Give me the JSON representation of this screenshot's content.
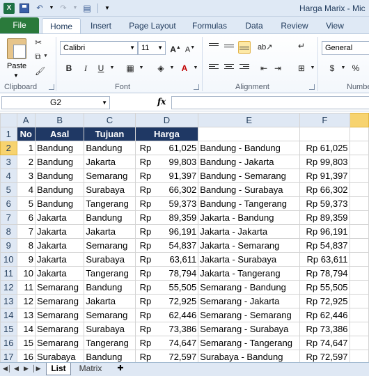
{
  "window": {
    "title": "Harga Marix - Mic"
  },
  "ribbon": {
    "tabs": [
      "File",
      "Home",
      "Insert",
      "Page Layout",
      "Formulas",
      "Data",
      "Review",
      "View"
    ],
    "clipboard": {
      "paste_label": "Paste",
      "group_label": "Clipboard"
    },
    "font": {
      "font_name": "Calibri",
      "font_size": "11",
      "group_label": "Font",
      "bold": "B",
      "italic": "I",
      "underline": "U"
    },
    "alignment": {
      "group_label": "Alignment"
    },
    "number": {
      "format": "General",
      "currency": "$",
      "percent": "%",
      "group_label": "Numbe"
    }
  },
  "formula_bar": {
    "name_box": "G2",
    "fx": "fx",
    "value": ""
  },
  "grid": {
    "columns": [
      "A",
      "B",
      "C",
      "D",
      "E",
      "F"
    ],
    "header_row": {
      "no": "No",
      "asal": "Asal",
      "tujuan": "Tujuan",
      "harga": "Harga"
    },
    "rows": [
      {
        "n": "2",
        "no": "1",
        "asal": "Bandung",
        "tujuan": "Bandung",
        "rp": "Rp",
        "harga": "61,025",
        "route": "Bandung - Bandung",
        "price": "Rp 61,025"
      },
      {
        "n": "3",
        "no": "2",
        "asal": "Bandung",
        "tujuan": "Jakarta",
        "rp": "Rp",
        "harga": "99,803",
        "route": "Bandung - Jakarta",
        "price": "Rp 99,803"
      },
      {
        "n": "4",
        "no": "3",
        "asal": "Bandung",
        "tujuan": "Semarang",
        "rp": "Rp",
        "harga": "91,397",
        "route": "Bandung - Semarang",
        "price": "Rp 91,397"
      },
      {
        "n": "5",
        "no": "4",
        "asal": "Bandung",
        "tujuan": "Surabaya",
        "rp": "Rp",
        "harga": "66,302",
        "route": "Bandung - Surabaya",
        "price": "Rp 66,302"
      },
      {
        "n": "6",
        "no": "5",
        "asal": "Bandung",
        "tujuan": "Tangerang",
        "rp": "Rp",
        "harga": "59,373",
        "route": "Bandung - Tangerang",
        "price": "Rp 59,373"
      },
      {
        "n": "7",
        "no": "6",
        "asal": "Jakarta",
        "tujuan": "Bandung",
        "rp": "Rp",
        "harga": "89,359",
        "route": "Jakarta - Bandung",
        "price": "Rp 89,359"
      },
      {
        "n": "8",
        "no": "7",
        "asal": "Jakarta",
        "tujuan": "Jakarta",
        "rp": "Rp",
        "harga": "96,191",
        "route": "Jakarta - Jakarta",
        "price": "Rp 96,191"
      },
      {
        "n": "9",
        "no": "8",
        "asal": "Jakarta",
        "tujuan": "Semarang",
        "rp": "Rp",
        "harga": "54,837",
        "route": "Jakarta - Semarang",
        "price": "Rp 54,837"
      },
      {
        "n": "10",
        "no": "9",
        "asal": "Jakarta",
        "tujuan": "Surabaya",
        "rp": "Rp",
        "harga": "63,611",
        "route": "Jakarta - Surabaya",
        "price": "Rp 63,611"
      },
      {
        "n": "11",
        "no": "10",
        "asal": "Jakarta",
        "tujuan": "Tangerang",
        "rp": "Rp",
        "harga": "78,794",
        "route": "Jakarta - Tangerang",
        "price": "Rp 78,794"
      },
      {
        "n": "12",
        "no": "11",
        "asal": "Semarang",
        "tujuan": "Bandung",
        "rp": "Rp",
        "harga": "55,505",
        "route": "Semarang - Bandung",
        "price": "Rp 55,505"
      },
      {
        "n": "13",
        "no": "12",
        "asal": "Semarang",
        "tujuan": "Jakarta",
        "rp": "Rp",
        "harga": "72,925",
        "route": "Semarang - Jakarta",
        "price": "Rp 72,925"
      },
      {
        "n": "14",
        "no": "13",
        "asal": "Semarang",
        "tujuan": "Semarang",
        "rp": "Rp",
        "harga": "62,446",
        "route": "Semarang - Semarang",
        "price": "Rp 62,446"
      },
      {
        "n": "15",
        "no": "14",
        "asal": "Semarang",
        "tujuan": "Surabaya",
        "rp": "Rp",
        "harga": "73,386",
        "route": "Semarang - Surabaya",
        "price": "Rp 73,386"
      },
      {
        "n": "16",
        "no": "15",
        "asal": "Semarang",
        "tujuan": "Tangerang",
        "rp": "Rp",
        "harga": "74,647",
        "route": "Semarang - Tangerang",
        "price": "Rp 74,647"
      },
      {
        "n": "17",
        "no": "16",
        "asal": "Surabaya",
        "tujuan": "Bandung",
        "rp": "Rp",
        "harga": "72,597",
        "route": "Surabaya - Bandung",
        "price": "Rp 72,597"
      }
    ]
  },
  "sheets": {
    "active": "List",
    "other": "Matrix"
  },
  "colors": {
    "header_fill": "#1f3864",
    "file_tab": "#2a7a3b",
    "selection": "#f7d36f"
  }
}
